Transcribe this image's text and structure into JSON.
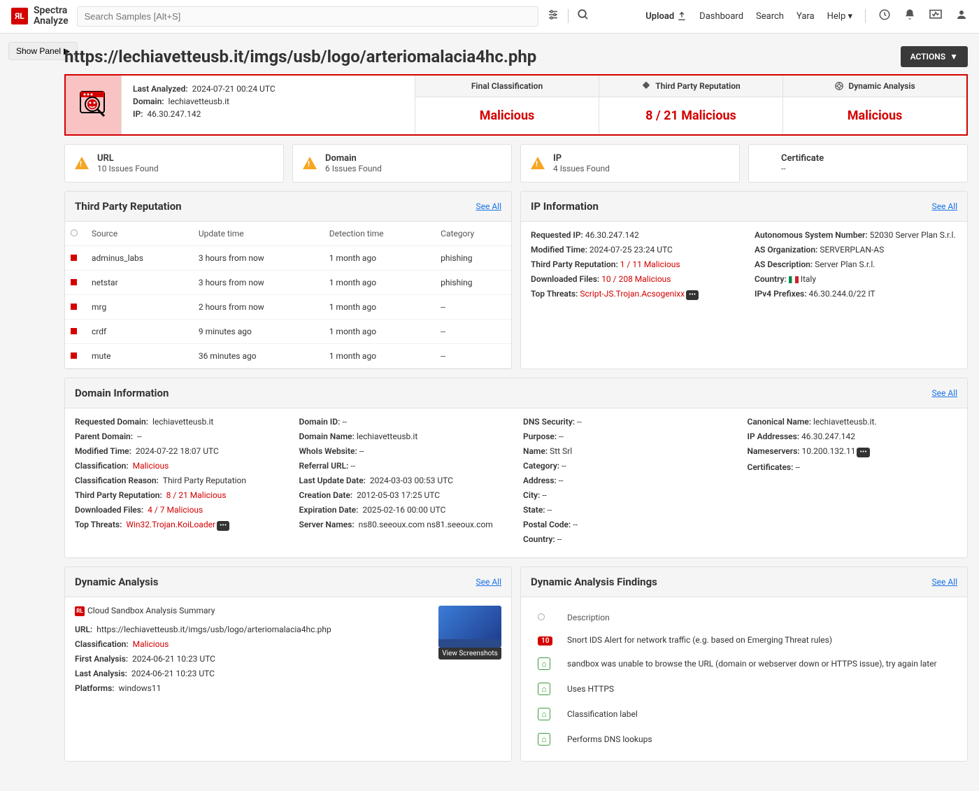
{
  "brand": {
    "badge": "ЯL",
    "name": "Spectra\nAnalyze"
  },
  "search": {
    "placeholder": "Search Samples [Alt+S]"
  },
  "nav": {
    "upload": "Upload",
    "dashboard": "Dashboard",
    "search": "Search",
    "yara": "Yara",
    "help": "Help"
  },
  "show_panel": "Show Panel",
  "page_title": "https://lechiavetteusb.it/imgs/usb/logo/arteriomalacia4hc.php",
  "actions": "ACTIONS",
  "summary": {
    "last_analyzed_label": "Last Analyzed:",
    "last_analyzed": "2024-07-21 00:24 UTC",
    "domain_label": "Domain:",
    "domain": "lechiavetteusb.it",
    "ip_label": "IP:",
    "ip": "46.30.247.142",
    "cols": [
      {
        "head": "Final Classification",
        "body": "Malicious"
      },
      {
        "head": "Third Party Reputation",
        "body": "8 / 21 Malicious"
      },
      {
        "head": "Dynamic Analysis",
        "body": "Malicious"
      }
    ]
  },
  "issues": [
    {
      "title": "URL",
      "sub": "10 Issues Found",
      "warn": true
    },
    {
      "title": "Domain",
      "sub": "6 Issues Found",
      "warn": true
    },
    {
      "title": "IP",
      "sub": "4 Issues Found",
      "warn": true
    },
    {
      "title": "Certificate",
      "sub": "--",
      "warn": false
    }
  ],
  "reputation": {
    "title": "Third Party Reputation",
    "see_all": "See All",
    "cols": {
      "source": "Source",
      "update": "Update time",
      "detect": "Detection time",
      "cat": "Category"
    },
    "rows": [
      {
        "source": "adminus_labs",
        "update": "3 hours from now",
        "detect": "1 month ago",
        "cat": "phishing"
      },
      {
        "source": "netstar",
        "update": "3 hours from now",
        "detect": "1 month ago",
        "cat": "phishing"
      },
      {
        "source": "mrg",
        "update": "2 hours from now",
        "detect": "1 month ago",
        "cat": "--"
      },
      {
        "source": "crdf",
        "update": "9 minutes ago",
        "detect": "1 month ago",
        "cat": "--"
      },
      {
        "source": "mute",
        "update": "36 minutes ago",
        "detect": "1 month ago",
        "cat": "--"
      }
    ]
  },
  "ip_info": {
    "title": "IP Information",
    "see_all": "See All",
    "left": {
      "requested_ip_l": "Requested IP:",
      "requested_ip": "46.30.247.142",
      "modified_l": "Modified Time:",
      "modified": "2024-07-25 23:24 UTC",
      "tpr_l": "Third Party Reputation:",
      "tpr": "1 / 11 Malicious",
      "df_l": "Downloaded Files:",
      "df": "10 / 208 Malicious",
      "tt_l": "Top Threats:",
      "tt": "Script-JS.Trojan.Acsogenixx"
    },
    "right": {
      "asn_l": "Autonomous System Number:",
      "asn": "52030 Server Plan S.r.l.",
      "asorg_l": "AS Organization:",
      "asorg": "SERVERPLAN-AS",
      "asdesc_l": "AS Description:",
      "asdesc": "Server Plan S.r.l.",
      "country_l": "Country:",
      "country": "Italy",
      "prefix_l": "IPv4 Prefixes:",
      "prefix": "46.30.244.0/22 IT"
    }
  },
  "domain_info": {
    "title": "Domain Information",
    "see_all": "See All",
    "c1": {
      "rd_l": "Requested Domain:",
      "rd": "lechiavetteusb.it",
      "pd_l": "Parent Domain:",
      "pd": "--",
      "mt_l": "Modified Time:",
      "mt": "2024-07-22 18:07 UTC",
      "cl_l": "Classification:",
      "cl": "Malicious",
      "cr_l": "Classification Reason:",
      "cr": "Third Party Reputation",
      "tpr_l": "Third Party Reputation:",
      "tpr": "8 / 21 Malicious",
      "df_l": "Downloaded Files:",
      "df": "4 / 7 Malicious",
      "tt_l": "Top Threats:",
      "tt": "Win32.Trojan.KoiLoader"
    },
    "c2": {
      "did_l": "Domain ID:",
      "did": "--",
      "dn_l": "Domain Name:",
      "dn": "lechiavetteusb.it",
      "ww_l": "WhoIs Website:",
      "ww": "--",
      "ru_l": "Referral URL:",
      "ru": "--",
      "lud_l": "Last Update Date:",
      "lud": "2024-03-03 00:53 UTC",
      "cd_l": "Creation Date:",
      "cd": "2012-05-03 17:25 UTC",
      "ed_l": "Expiration Date:",
      "ed": "2025-02-16 00:00 UTC",
      "sn_l": "Server Names:",
      "sn": "ns80.seeoux.com ns81.seeoux.com"
    },
    "c3": {
      "dns_l": "DNS Security:",
      "dns": "--",
      "purp_l": "Purpose:",
      "purp": "--",
      "name_l": "Name:",
      "name": "Stt Srl",
      "cat_l": "Category:",
      "cat": "--",
      "addr_l": "Address:",
      "addr": "--",
      "city_l": "City:",
      "city": "--",
      "state_l": "State:",
      "state": "--",
      "pc_l": "Postal Code:",
      "pc": "--",
      "country_l": "Country:",
      "country": "--"
    },
    "c4": {
      "cn_l": "Canonical Name:",
      "cn": "lechiavetteusb.it.",
      "ip_l": "IP Addresses:",
      "ip": "46.30.247.142",
      "ns_l": "Nameservers:",
      "ns": "10.200.132.11",
      "cert_l": "Certificates:",
      "cert": "--"
    }
  },
  "dyn_analysis": {
    "title": "Dynamic Analysis",
    "see_all": "See All",
    "sandbox_title": "Cloud Sandbox Analysis Summary",
    "url_l": "URL:",
    "url": "https://lechiavetteusb.it/imgs/usb/logo/arteriomalacia4hc.php",
    "cl_l": "Classification:",
    "cl": "Malicious",
    "fa_l": "First Analysis:",
    "fa": "2024-06-21 10:23 UTC",
    "la_l": "Last Analysis:",
    "la": "2024-06-21 10:23 UTC",
    "pl_l": "Platforms:",
    "pl": "windows11",
    "view_screenshots": "View Screenshots"
  },
  "findings": {
    "title": "Dynamic Analysis Findings",
    "see_all": "See All",
    "desc_col": "Description",
    "rows": [
      {
        "badge": "10",
        "type": "red",
        "desc": "Snort IDS Alert for network traffic (e.g. based on Emerging Threat rules)"
      },
      {
        "badge": "⌂",
        "type": "green",
        "desc": "sandbox was unable to browse the URL (domain or webserver down or HTTPS issue), try again later"
      },
      {
        "badge": "⌂",
        "type": "green",
        "desc": "Uses HTTPS"
      },
      {
        "badge": "⌂",
        "type": "green",
        "desc": "Classification label"
      },
      {
        "badge": "⌂",
        "type": "green",
        "desc": "Performs DNS lookups"
      }
    ]
  }
}
